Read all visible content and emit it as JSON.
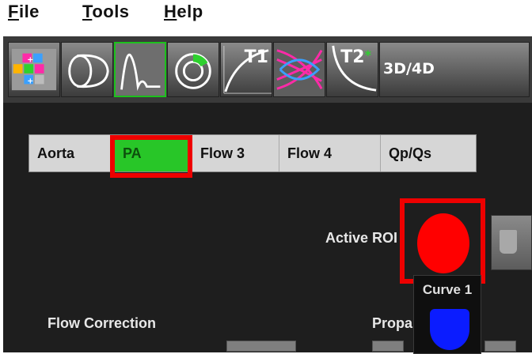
{
  "menu": {
    "file": {
      "first": "F",
      "rest": "ile"
    },
    "tools": {
      "first": "T",
      "rest": "ools"
    },
    "help": {
      "first": "H",
      "rest": "elp"
    }
  },
  "toolbar": {
    "tools": [
      {
        "name": "matrix-tool"
      },
      {
        "name": "function-tool"
      },
      {
        "name": "flow-tool",
        "active": true
      },
      {
        "name": "myocardial-evaluation-tool"
      },
      {
        "name": "t1-mapping-tool",
        "label": "T1"
      },
      {
        "name": "signal-intensity-tool"
      },
      {
        "name": "t2star-tool",
        "label": "T2",
        "label_sup": "*"
      },
      {
        "name": "3d4d-tool",
        "label": "3D/4D"
      }
    ]
  },
  "tabs": [
    {
      "label": "Aorta",
      "selected": false
    },
    {
      "label": "PA",
      "selected": true
    },
    {
      "label": "Flow 3",
      "selected": false
    },
    {
      "label": "Flow 4",
      "selected": false
    },
    {
      "label": "Qp/Qs",
      "selected": false
    }
  ],
  "roi": {
    "label": "Active ROI",
    "color": "#ff0000"
  },
  "curve": {
    "label": "Curve 1",
    "color": "#0b1cff"
  },
  "flow_correction": {
    "label": "Flow Correction"
  },
  "propagate": {
    "label": "Propa"
  },
  "colors": {
    "highlight": "#ee0000",
    "active_tool": "#1cc11c",
    "selected_tab": "#28c628"
  }
}
